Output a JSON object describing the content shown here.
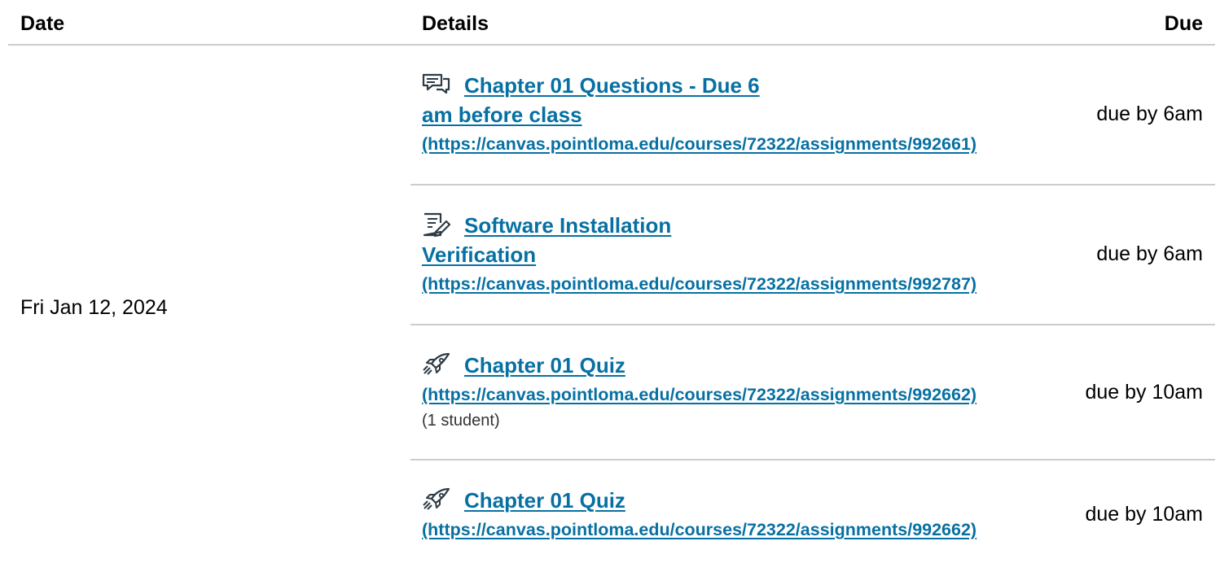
{
  "table": {
    "headers": {
      "date": "Date",
      "details": "Details",
      "due": "Due"
    },
    "date": "Fri Jan 12, 2024",
    "rows": [
      {
        "icon": "discussion-icon",
        "title_line1": "Chapter 01 Questions - Due 6",
        "title_line2": "am before class",
        "url": "(https://canvas.pointloma.edu/courses/72322/assignments/992661)",
        "due": "due by 6am"
      },
      {
        "icon": "assignment-icon",
        "title_line1": "Software Installation",
        "title_line2": "Verification",
        "url": "(https://canvas.pointloma.edu/courses/72322/assignments/992787)",
        "due": "due by 6am"
      },
      {
        "icon": "quiz-rocket-icon",
        "title_line1": "Chapter 01 Quiz",
        "url": "(https://canvas.pointloma.edu/courses/72322/assignments/992662)",
        "note": "(1 student)",
        "due": "due by 10am"
      },
      {
        "icon": "quiz-rocket-icon",
        "title_line1": "Chapter 01 Quiz",
        "url": "(https://canvas.pointloma.edu/courses/72322/assignments/992662)",
        "due": "due by 10am"
      }
    ]
  },
  "colors": {
    "link": "#0770a3",
    "divider": "#c7cdd1",
    "text": "#000000"
  }
}
